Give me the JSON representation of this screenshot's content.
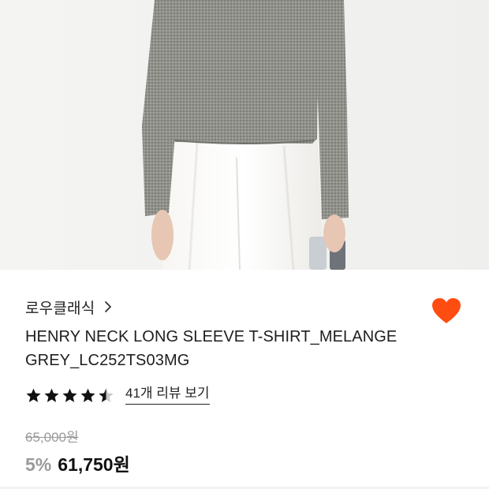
{
  "product_image": {
    "description_icon": "product-photo"
  },
  "brand": {
    "name": "로우클래식",
    "chevron_icon": "chevron-right-icon"
  },
  "wishlist": {
    "icon": "heart-icon",
    "active": true,
    "color": "#ff4d12"
  },
  "product": {
    "title": "HENRY NECK LONG SLEEVE T-SHIRT_MELANGE GREY_LC252TS03MG"
  },
  "rating": {
    "stars": 4.5,
    "max": 5,
    "review_link": "41개 리뷰 보기"
  },
  "pricing": {
    "original_price": "65,000원",
    "discount": "5%",
    "sale_price": "61,750원"
  }
}
